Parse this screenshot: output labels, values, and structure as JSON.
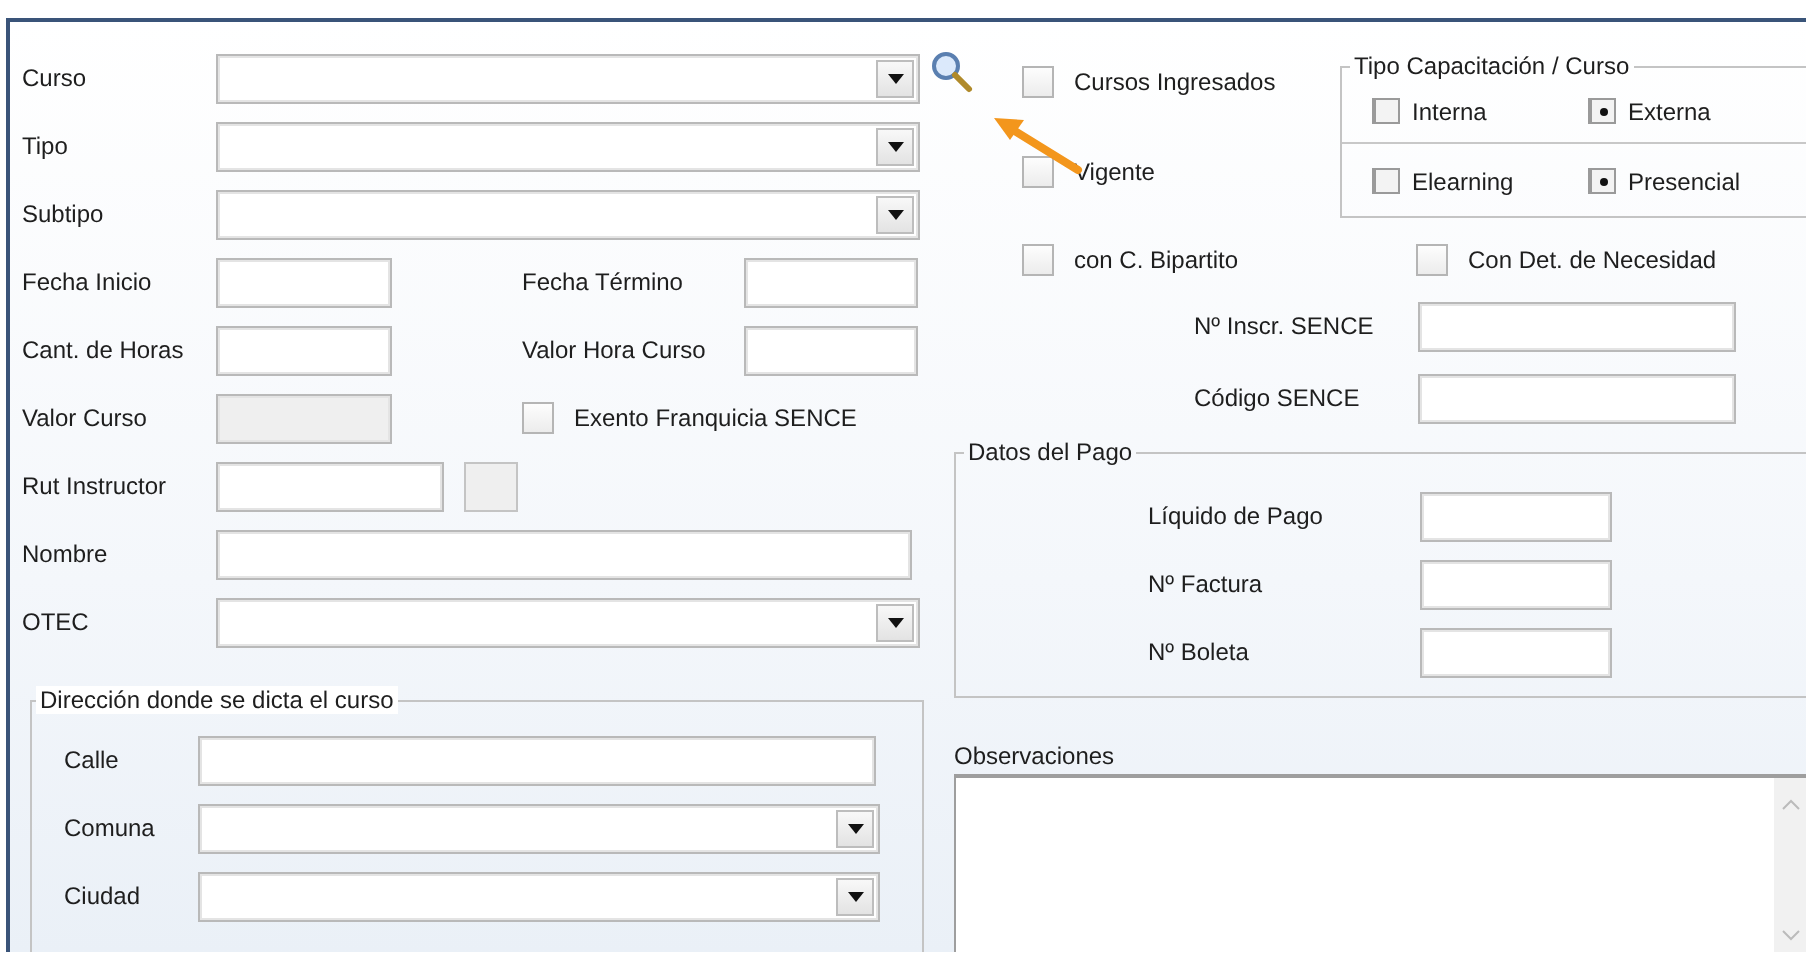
{
  "form_rows": [
    {
      "kind": "combo",
      "label": "Curso",
      "search_button": true
    },
    {
      "kind": "combo",
      "label": "Tipo"
    },
    {
      "kind": "combo",
      "label": "Subtipo"
    },
    {
      "kind": "pair",
      "label": "Fecha Inicio",
      "label_2": "Fecha Término"
    },
    {
      "kind": "pair",
      "label": "Cant. de Horas",
      "label_2": "Valor Hora Curso"
    },
    {
      "kind": "readonly_check",
      "label": "Valor Curso",
      "check_label": "Exento Franquicia SENCE",
      "checked": false
    },
    {
      "kind": "rut",
      "label": "Rut Instructor"
    },
    {
      "kind": "text",
      "label": "Nombre"
    },
    {
      "kind": "combo",
      "label": "OTEC"
    }
  ],
  "address": {
    "title": "Dirección donde se dicta el curso",
    "rows": [
      {
        "kind": "text",
        "label": "Calle"
      },
      {
        "kind": "combo",
        "label": "Comuna"
      },
      {
        "kind": "combo",
        "label": "Ciudad"
      }
    ]
  },
  "options": [
    {
      "label": "Cursos Ingresados",
      "checked": false
    },
    {
      "label": "Vigente",
      "checked": false
    }
  ],
  "tipo_capacitacion": {
    "title": "Tipo Capacitación / Curso",
    "groups": [
      {
        "choices": [
          {
            "label": "Interna",
            "selected": false
          },
          {
            "label": "Externa",
            "selected": true
          }
        ]
      },
      {
        "choices": [
          {
            "label": "Elearning",
            "selected": false
          },
          {
            "label": "Presencial",
            "selected": true
          }
        ]
      }
    ]
  },
  "flags": [
    {
      "label": "con C. Bipartito",
      "checked": false
    },
    {
      "label": "Con Det. de Necesidad",
      "checked": false
    }
  ],
  "sence_fields": [
    {
      "label": "Nº Inscr. SENCE"
    },
    {
      "label": "Código SENCE"
    }
  ],
  "datos_pago": {
    "title": "Datos del Pago",
    "fields": [
      {
        "label": "Líquido de Pago"
      },
      {
        "label": "Nº Factura"
      },
      {
        "label": "Nº Boleta"
      }
    ]
  },
  "observaciones": {
    "label": "Observaciones"
  }
}
